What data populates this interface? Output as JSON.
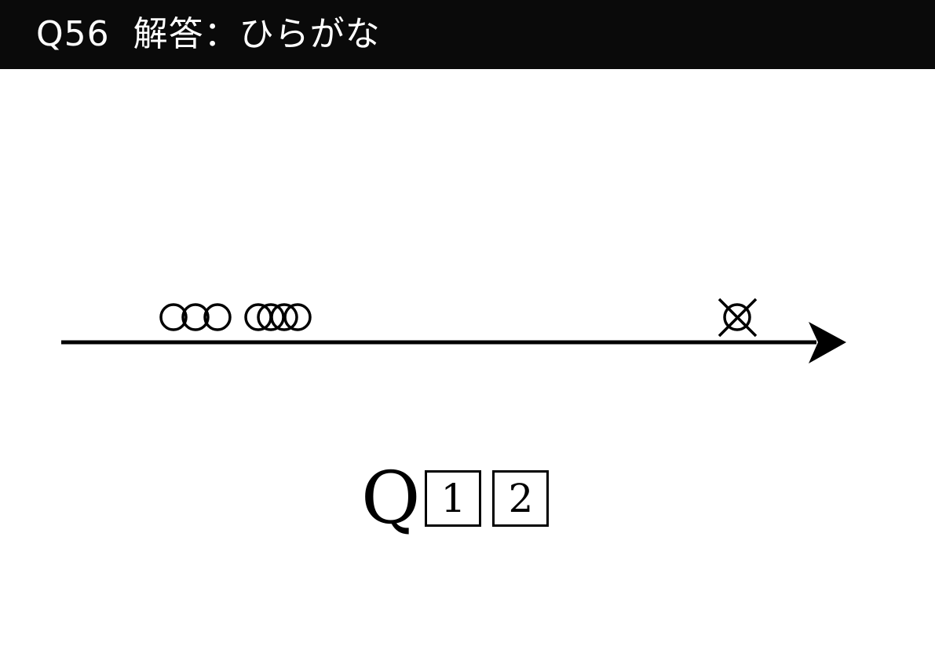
{
  "header": {
    "title": "Q56  解答：ひらがな",
    "background": "#0a0a0a",
    "text_color": "#ffffff"
  },
  "diagram": {
    "line_color": "#000000",
    "markers": [
      {
        "type": "circle",
        "count": 3
      },
      {
        "type": "circle",
        "count": 4
      },
      {
        "type": "circle-with-x",
        "count": 1
      }
    ]
  },
  "question": {
    "letter": "Q",
    "digits": [
      "1",
      "2"
    ]
  }
}
